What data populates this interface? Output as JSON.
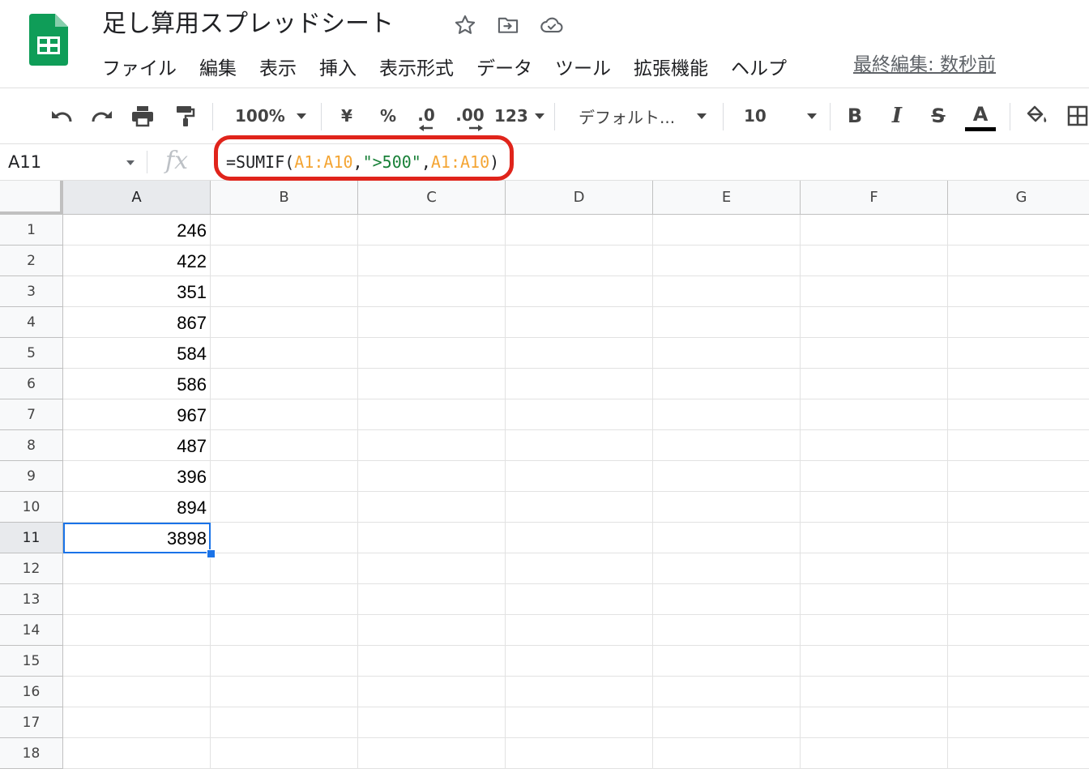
{
  "app": {
    "title": "足し算用スプレッドシート",
    "last_edit": "最終編集: 数秒前",
    "menu": [
      "ファイル",
      "編集",
      "表示",
      "挿入",
      "表示形式",
      "データ",
      "ツール",
      "拡張機能",
      "ヘルプ"
    ]
  },
  "toolbar": {
    "zoom": "100%",
    "currency": "¥",
    "percent": "%",
    "decrease_decimal": ".0",
    "increase_decimal": ".00",
    "number_format": "123",
    "font": "デフォルト...",
    "font_size": "10",
    "bold": "B",
    "italic": "I",
    "strikethrough": "S",
    "text_color": "A"
  },
  "formula_bar": {
    "name_box": "A11",
    "fx_label": "fx",
    "formula": {
      "prefix": "=SUMIF(",
      "range1": "A1:A10",
      "comma1": ",",
      "criterion": "\">500\"",
      "comma2": ",",
      "range2": "A1:A10",
      "suffix": ")"
    }
  },
  "grid": {
    "columns": [
      "A",
      "B",
      "C",
      "D",
      "E",
      "F",
      "G"
    ],
    "rows": [
      "1",
      "2",
      "3",
      "4",
      "5",
      "6",
      "7",
      "8",
      "9",
      "10",
      "11",
      "12",
      "13",
      "14",
      "15",
      "16",
      "17",
      "18"
    ],
    "column_a_values": [
      "246",
      "422",
      "351",
      "867",
      "584",
      "586",
      "967",
      "487",
      "396",
      "894",
      "3898"
    ],
    "selected_column": "A",
    "selected_row": "11"
  },
  "colors": {
    "accent": "#1a73e8",
    "highlight": "#e0241b",
    "sheets_green": "#0f9d58",
    "formula_ref": "#f4a534",
    "formula_string": "#188038"
  }
}
